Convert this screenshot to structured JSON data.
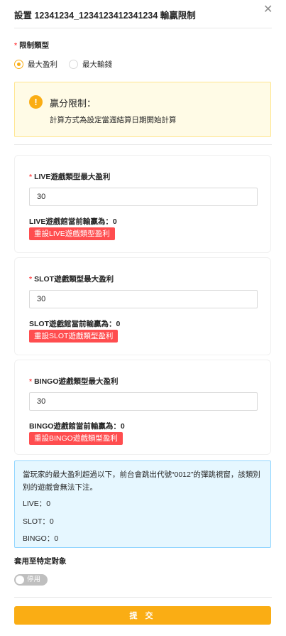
{
  "header": {
    "title": "設置 12341234_1234123412341234 輸贏限制",
    "close_icon": "close-icon"
  },
  "limit_type": {
    "label": "限制類型",
    "options": [
      {
        "label": "最大盈利",
        "checked": true
      },
      {
        "label": "最大輸錢",
        "checked": false
      }
    ]
  },
  "warning": {
    "icon": "exclamation-icon",
    "title": "贏分限制：",
    "description": "計算方式為設定當週結算日期開始計算"
  },
  "cards": [
    {
      "label": "LIVE遊戲類型最大盈利",
      "value": "30",
      "status": "LIVE遊戲館當前輸贏為：0",
      "reset_label": "重設LIVE遊戲類型盈利"
    },
    {
      "label": "SLOT遊戲類型最大盈利",
      "value": "30",
      "status": "SLOT遊戲館當前輸贏為：0",
      "reset_label": "重設SLOT遊戲類型盈利"
    },
    {
      "label": "BINGO遊戲類型最大盈利",
      "value": "30",
      "status": "BINGO遊戲館當前輸贏為：0",
      "reset_label": "重設BINGO遊戲類型盈利"
    }
  ],
  "info": {
    "description": "當玩家的最大盈利超過以下，前台會跳出代號“0012”的彈跳視窗，該類別別的遊戲會無法下注。",
    "lines": [
      "LIVE：0",
      "SLOT：0",
      "BINGO：0"
    ]
  },
  "apply": {
    "label": "套用至特定對象",
    "switch_text": "停用",
    "enabled": false
  },
  "submit_label": "提 交",
  "colors": {
    "accent": "#faad14",
    "danger": "#ff4d4f",
    "info_bg": "#e6f7ff",
    "warn_bg": "#fffbe6"
  }
}
